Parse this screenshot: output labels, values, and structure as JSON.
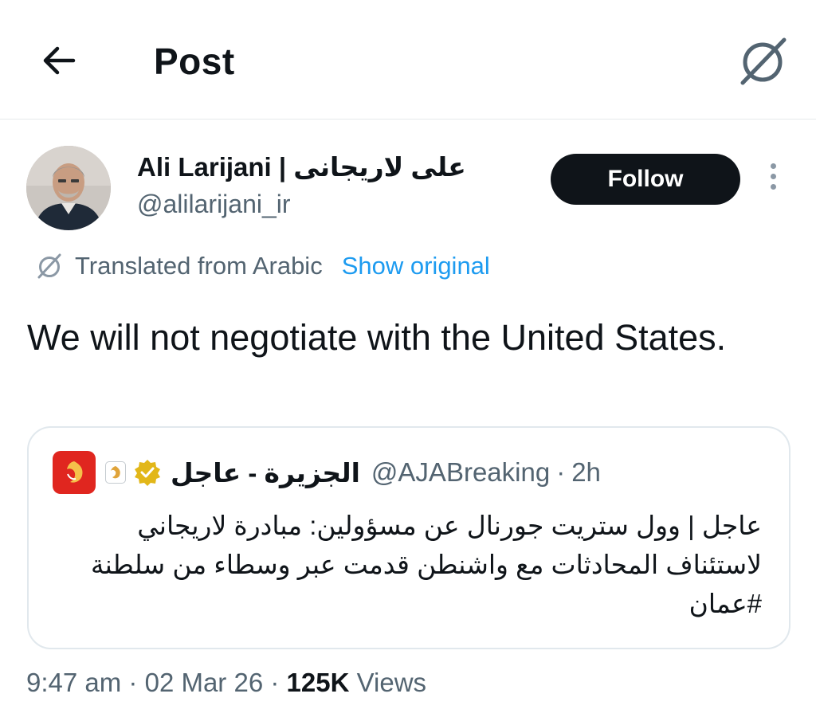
{
  "header": {
    "title": "Post",
    "back_icon": "arrow-left-icon",
    "translate_icon": "translate-slash-icon"
  },
  "author": {
    "display_name": "Ali Larijani | على لاريجانى",
    "handle": "@alilarijani_ir",
    "avatar_icon": "avatar-photo",
    "follow_label": "Follow",
    "more_icon": "more-vertical-icon"
  },
  "translation": {
    "text": "Translated from Arabic",
    "show_original_label": "Show original",
    "icon": "translate-slash-icon"
  },
  "tweet": {
    "text": "We will not negotiate with the United States."
  },
  "quote": {
    "name": "الجزيرة - عاجل",
    "handle": "@AJABreaking",
    "separator": "·",
    "time": "2h",
    "verified_color": "#e2b719",
    "logo_color": "#e0261f",
    "body": "عاجل | وول ستريت جورنال عن مسؤولين: مبادرة لاريجاني لاستئناف المحادثات مع واشنطن قدمت عبر وسطاء من سلطنة #عمان"
  },
  "meta": {
    "time": "9:47 am",
    "sep1": "·",
    "date": "02 Mar 26",
    "sep2": "·",
    "views_count": "125K",
    "views_label": "Views"
  },
  "colors": {
    "text_primary": "#0f1419",
    "text_secondary": "#536471",
    "link": "#1d9bf0",
    "border": "#e1e8ed"
  }
}
